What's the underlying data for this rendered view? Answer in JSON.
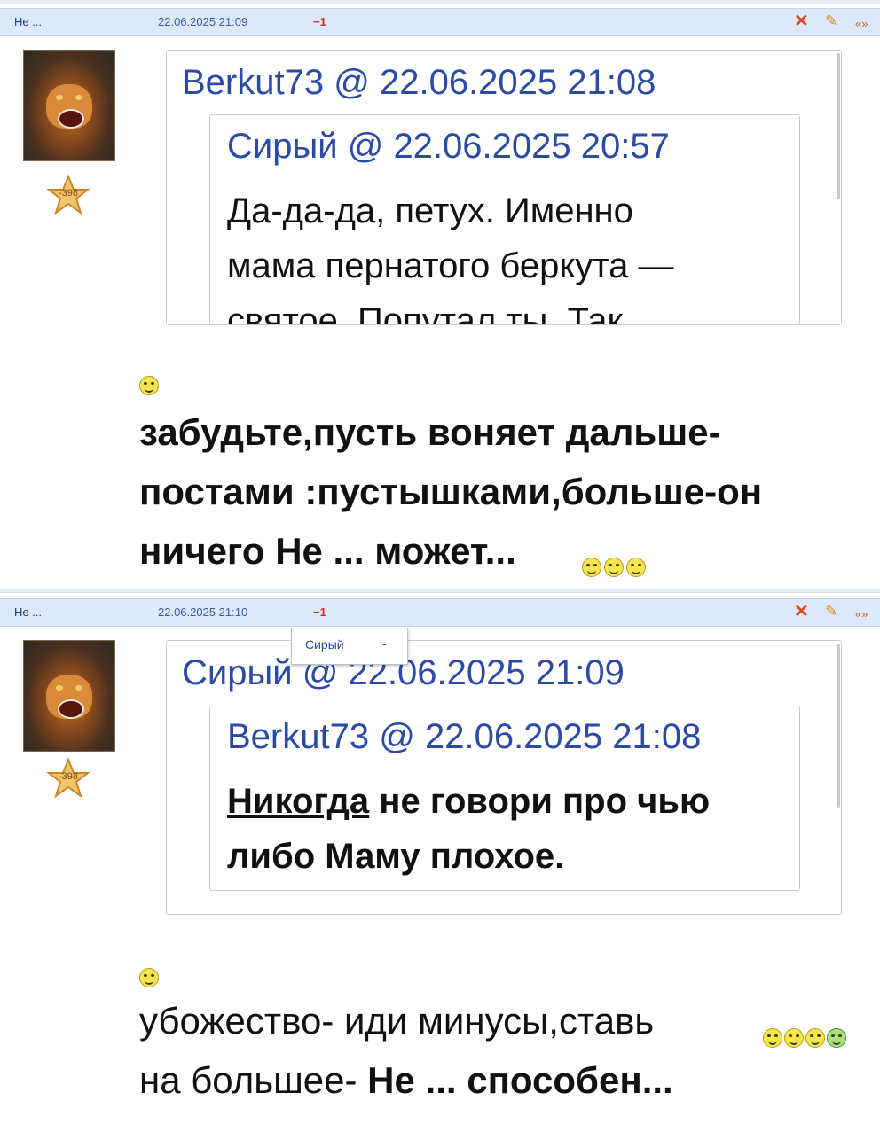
{
  "post1": {
    "author": "Не ...",
    "date": "22.06.2025 21:09",
    "score": "−1",
    "actions": {
      "delete": "✕",
      "edit": "✎",
      "quote": "«»"
    },
    "rating": "-398",
    "quote_outer": {
      "author": "Berkut73",
      "sep": "@",
      "date": "22.06.2025 21:08"
    },
    "quote_inner": {
      "author": "Сирый",
      "sep": "@",
      "date": "22.06.2025 20:57",
      "lines": [
        "Да-да-да, петух. Именно",
        "мама пернатого беркута —",
        "святое. Попутал ты. Так"
      ]
    },
    "message_lines": [
      "забудьте,пусть воняет дальше-",
      "постами :пустышками,больше-он",
      "ничего Не ... может..."
    ]
  },
  "post2": {
    "author": "Не ...",
    "date": "22.06.2025 21:10",
    "score": "−1",
    "actions": {
      "delete": "✕",
      "edit": "✎",
      "quote": "«»"
    },
    "rating": "-398",
    "quote_outer": {
      "author": "Сирый",
      "sep": "@",
      "date": "22.06.2025 21:09"
    },
    "quote_inner": {
      "author": "Berkut73",
      "sep": "@",
      "date": "22.06.2025 21:08",
      "underline_word": "Никогда",
      "line1_rest": " не говори про чью",
      "line2": "либо Маму плохое."
    },
    "message_line1": "убожество- иди минусы,ставь",
    "message_line2_normal": "на большее- ",
    "message_line2_bold": "Не ... способен..."
  },
  "tooltip": {
    "name": "Сирый",
    "dash": "-"
  },
  "colors": {
    "header_bg": "#dce9fa",
    "link": "#2b4aa5",
    "score": "#d42a1e",
    "delete": "#e64a1a"
  }
}
